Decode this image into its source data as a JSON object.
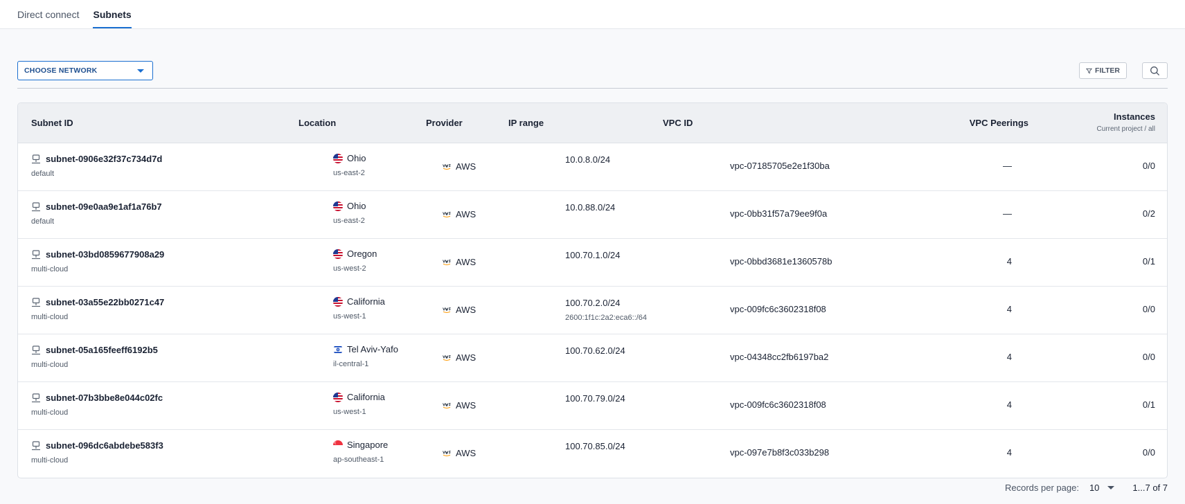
{
  "tabs": [
    {
      "label": "Direct connect",
      "active": false
    },
    {
      "label": "Subnets",
      "active": true
    }
  ],
  "toolbar": {
    "network_select": "CHOOSE NETWORK",
    "filter_label": "FILTER"
  },
  "table": {
    "columns": {
      "subnet_id": "Subnet ID",
      "location": "Location",
      "provider": "Provider",
      "ip_range": "IP range",
      "vpc_id": "VPC ID",
      "vpc_peerings": "VPC Peerings",
      "instances": "Instances",
      "instances_sub": "Current project / all"
    },
    "rows": [
      {
        "id": "subnet-0906e32f37c734d7d",
        "network": "default",
        "location": "Ohio",
        "region": "us-east-2",
        "flag": "us",
        "provider": "AWS",
        "ip": "10.0.8.0/24",
        "ipv6": "",
        "vpc": "vpc-07185705e2e1f30ba",
        "peerings": "—",
        "instances": "0/0"
      },
      {
        "id": "subnet-09e0aa9e1af1a76b7",
        "network": "default",
        "location": "Ohio",
        "region": "us-east-2",
        "flag": "us",
        "provider": "AWS",
        "ip": "10.0.88.0/24",
        "ipv6": "",
        "vpc": "vpc-0bb31f57a79ee9f0a",
        "peerings": "—",
        "instances": "0/2"
      },
      {
        "id": "subnet-03bd0859677908a29",
        "network": "multi-cloud",
        "location": "Oregon",
        "region": "us-west-2",
        "flag": "us",
        "provider": "AWS",
        "ip": "100.70.1.0/24",
        "ipv6": "",
        "vpc": "vpc-0bbd3681e1360578b",
        "peerings": "4",
        "instances": "0/1"
      },
      {
        "id": "subnet-03a55e22bb0271c47",
        "network": "multi-cloud",
        "location": "California",
        "region": "us-west-1",
        "flag": "us",
        "provider": "AWS",
        "ip": "100.70.2.0/24",
        "ipv6": "2600:1f1c:2a2:eca6::/64",
        "vpc": "vpc-009fc6c3602318f08",
        "peerings": "4",
        "instances": "0/0"
      },
      {
        "id": "subnet-05a165feeff6192b5",
        "network": "multi-cloud",
        "location": "Tel Aviv-Yafo",
        "region": "il-central-1",
        "flag": "il",
        "provider": "AWS",
        "ip": "100.70.62.0/24",
        "ipv6": "",
        "vpc": "vpc-04348cc2fb6197ba2",
        "peerings": "4",
        "instances": "0/0"
      },
      {
        "id": "subnet-07b3bbe8e044c02fc",
        "network": "multi-cloud",
        "location": "California",
        "region": "us-west-1",
        "flag": "us",
        "provider": "AWS",
        "ip": "100.70.79.0/24",
        "ipv6": "",
        "vpc": "vpc-009fc6c3602318f08",
        "peerings": "4",
        "instances": "0/1"
      },
      {
        "id": "subnet-096dc6abdebe583f3",
        "network": "multi-cloud",
        "location": "Singapore",
        "region": "ap-southeast-1",
        "flag": "sg",
        "provider": "AWS",
        "ip": "100.70.85.0/24",
        "ipv6": "",
        "vpc": "vpc-097e7b8f3c033b298",
        "peerings": "4",
        "instances": "0/0"
      }
    ]
  },
  "pagination": {
    "records_label": "Records per page:",
    "per_page": "10",
    "range": "1...7 of 7"
  },
  "colors": {
    "accent": "#1a6fd0",
    "header_bg": "#eef0f3"
  },
  "icons": {
    "subnet": "network-node-icon",
    "provider": "aws-logo-icon",
    "filter": "funnel-icon",
    "search": "search-icon"
  }
}
